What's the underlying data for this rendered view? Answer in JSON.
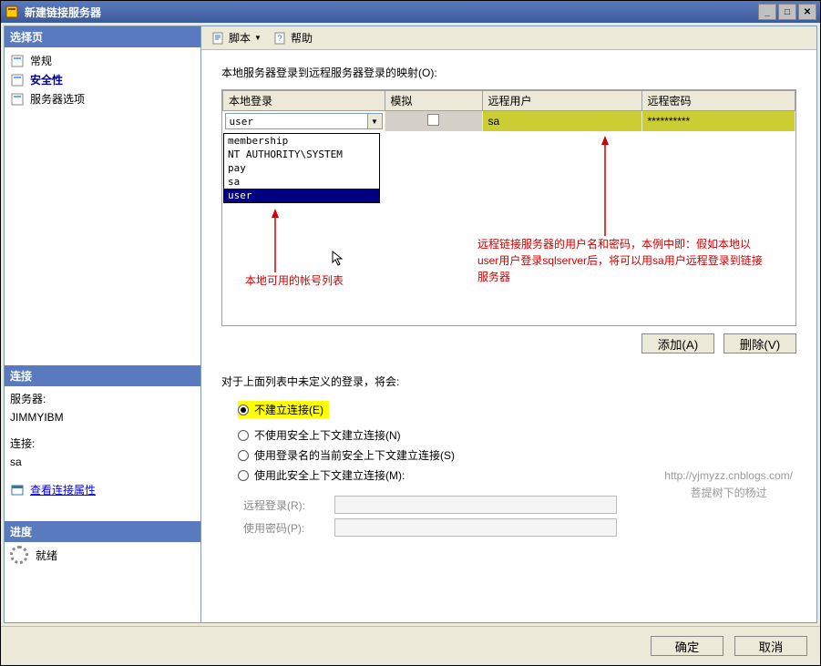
{
  "window": {
    "title": "新建链接服务器"
  },
  "sidebar": {
    "select_header": "选择页",
    "nav": [
      {
        "label": "常规"
      },
      {
        "label": "安全性"
      },
      {
        "label": "服务器选项"
      }
    ],
    "conn_header": "连接",
    "server_label": "服务器:",
    "server_value": "JIMMYIBM",
    "conn_label": "连接:",
    "conn_value": "sa",
    "view_conn_link": "查看连接属性",
    "progress_header": "进度",
    "status": "就绪"
  },
  "toolbar": {
    "script": "脚本",
    "help": "帮助"
  },
  "panel": {
    "mapping_label": "本地服务器登录到远程服务器登录的映射(O):",
    "columns": {
      "local": "本地登录",
      "impersonate": "模拟",
      "remote_user": "远程用户",
      "remote_pwd": "远程密码"
    },
    "row": {
      "local_value": "user",
      "remote_user": "sa",
      "remote_pwd": "**********"
    },
    "dropdown": [
      "membership",
      "NT AUTHORITY\\SYSTEM",
      "pay",
      "sa",
      "user"
    ],
    "annot_left": "本地可用的帐号列表",
    "annot_right": "远程链接服务器的用户名和密码，本例中即：假如本地以user用户登录sqlserver后，将可以用sa用户远程登录到链接服务器",
    "btn_add": "添加(A)",
    "btn_del": "删除(V)",
    "section2_label": "对于上面列表中未定义的登录，将会:",
    "radios": {
      "r1": "不建立连接(E)",
      "r2": "不使用安全上下文建立连接(N)",
      "r3": "使用登录名的当前安全上下文建立连接(S)",
      "r4": "使用此安全上下文建立连接(M):"
    },
    "remote_login_label": "远程登录(R):",
    "use_pwd_label": "使用密码(P):",
    "watermark1": "http://yjmyzz.cnblogs.com/",
    "watermark2": "菩提树下的杨过"
  },
  "footer": {
    "ok": "确定",
    "cancel": "取消"
  }
}
